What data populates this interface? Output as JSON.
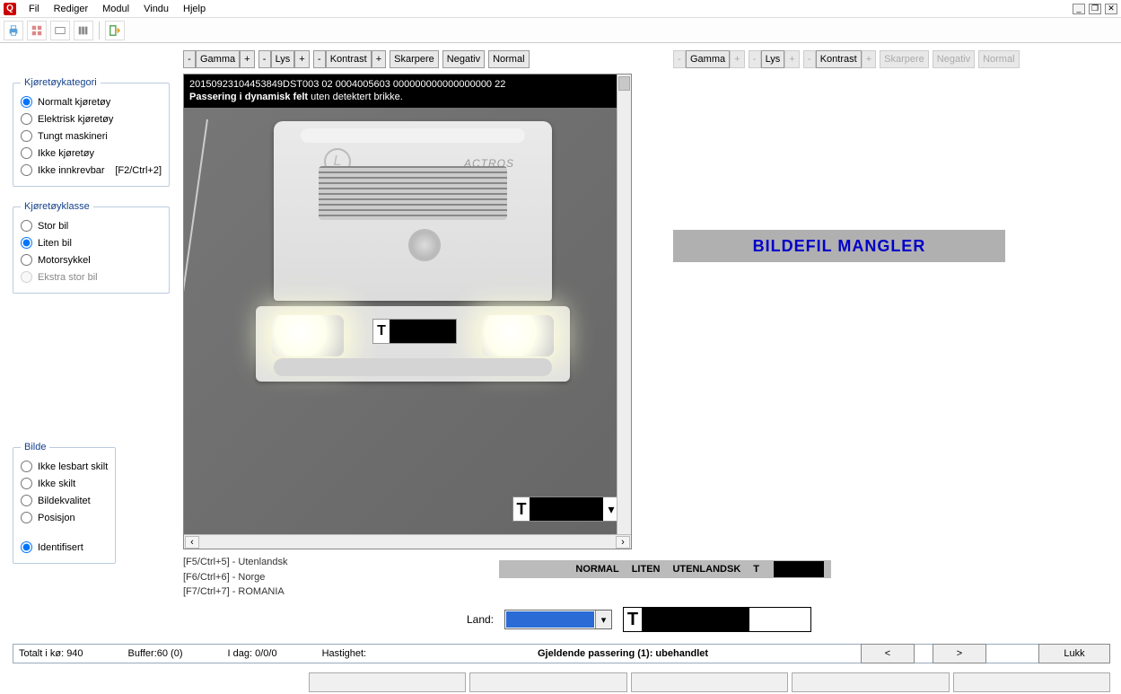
{
  "menu": {
    "items": [
      "Fil",
      "Rediger",
      "Modul",
      "Vindu",
      "Hjelp"
    ]
  },
  "window_controls": {
    "min": "_",
    "max": "❐",
    "close": "✕"
  },
  "fieldsets": {
    "kategori": {
      "legend": "Kjøretøykategori",
      "options": [
        {
          "label": "Normalt kjøretøy",
          "checked": true
        },
        {
          "label": "Elektrisk kjøretøy",
          "checked": false
        },
        {
          "label": "Tungt maskineri",
          "checked": false
        },
        {
          "label": "Ikke kjøretøy",
          "checked": false
        },
        {
          "label": "Ikke innkrevbar",
          "checked": false,
          "hint": "[F2/Ctrl+2]"
        }
      ]
    },
    "klasse": {
      "legend": "Kjøretøyklasse",
      "options": [
        {
          "label": "Stor bil",
          "checked": false
        },
        {
          "label": "Liten bil",
          "checked": true
        },
        {
          "label": "Motorsykkel",
          "checked": false
        },
        {
          "label": "Ekstra stor bil",
          "checked": false,
          "disabled": true
        }
      ]
    },
    "bilde": {
      "legend": "Bilde",
      "options": [
        {
          "label": "Ikke lesbart skilt",
          "checked": false
        },
        {
          "label": "Ikke skilt",
          "checked": false
        },
        {
          "label": "Bildekvalitet",
          "checked": false
        },
        {
          "label": "Posisjon",
          "checked": false
        },
        {
          "label": "Identifisert",
          "checked": true,
          "gap": true
        }
      ]
    }
  },
  "image_tools": {
    "minus": "-",
    "plus": "+",
    "gamma": "Gamma",
    "lys": "Lys",
    "kontrast": "Kontrast",
    "skarpere": "Skarpere",
    "negativ": "Negativ",
    "normal": "Normal"
  },
  "image_overlay": {
    "line1": "20150923104453849DST003 02 0004005603 000000000000000000  22",
    "line2a": "Passering i dynamisk felt",
    "line2b": " uten detektert brikke."
  },
  "truck": {
    "brand": "ACTROS",
    "plate_letter": "T",
    "l_marker": "L"
  },
  "mini_plate": {
    "letter": "T"
  },
  "shortcuts": [
    "[F5/Ctrl+5] - Utenlandsk",
    "[F6/Ctrl+6] - Norge",
    "[F7/Ctrl+7] - ROMANIA"
  ],
  "right_panel": {
    "missing": "BILDEFIL MANGLER"
  },
  "summary": {
    "c1": "NORMAL",
    "c2": "LITEN",
    "c3": "UTENLANDSK",
    "c4": "T"
  },
  "land": {
    "label": "Land:",
    "plate_letter": "T"
  },
  "status": {
    "total_label": "Totalt i kø:",
    "total_value": "940",
    "buffer_label": "Buffer:",
    "buffer_value": "60 (0)",
    "idag_label": "I dag:",
    "idag_value": "0/0/0",
    "hastighet_label": "Hastighet:",
    "current": "Gjeldende passering (1):  ubehandlet"
  },
  "buttons": {
    "prev": "<",
    "next": ">",
    "close": "Lukk"
  }
}
